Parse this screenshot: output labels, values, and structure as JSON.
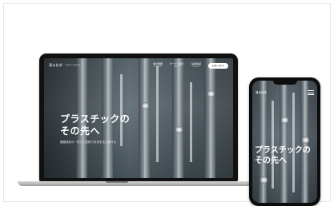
{
  "site": {
    "logo": "清水化学",
    "logo_sub": "SHIMIZU CHEMICAL",
    "nav": [
      {
        "label": "会社概要",
        "sub": "COMPANY"
      },
      {
        "label": "サービス紹介",
        "sub": "SERVICE"
      },
      {
        "label": "採用情報",
        "sub": "RECRUIT"
      }
    ],
    "cta": "お問い合わせ"
  },
  "hero": {
    "title_line1": "プラスチックの",
    "title_line2": "その先へ",
    "subtitle": "樹脂成形の一貫した技術で未来を支え続ける"
  },
  "phone": {
    "title_line1": "プラスチックの",
    "title_line2": "その先へ"
  }
}
